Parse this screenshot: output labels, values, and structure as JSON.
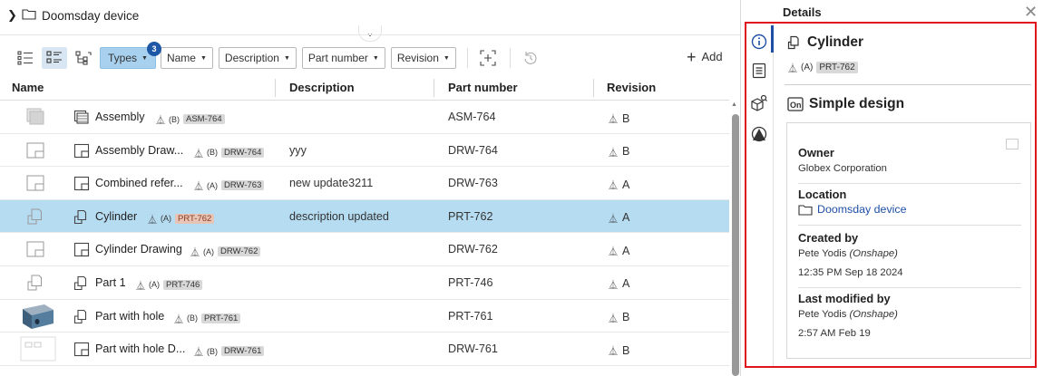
{
  "breadcrumb": {
    "folder": "Doomsday device"
  },
  "toolbar": {
    "filters": {
      "types": "Types",
      "types_count": "3",
      "name": "Name",
      "description": "Description",
      "part_number": "Part number",
      "revision": "Revision"
    },
    "add_label": "Add"
  },
  "columns": {
    "name": "Name",
    "description": "Description",
    "part_number": "Part number",
    "revision": "Revision"
  },
  "rows": [
    {
      "name": "Assembly",
      "rev": "(B)",
      "pn_chip": "ASM-764",
      "description": "",
      "part_number": "ASM-764",
      "revision": "B",
      "type": "assembly"
    },
    {
      "name": "Assembly Draw...",
      "rev": "(B)",
      "pn_chip": "DRW-764",
      "description": "yyy",
      "part_number": "DRW-764",
      "revision": "B",
      "type": "drawing"
    },
    {
      "name": "Combined refer...",
      "rev": "(A)",
      "pn_chip": "DRW-763",
      "description": "new update3211",
      "part_number": "DRW-763",
      "revision": "A",
      "type": "drawing"
    },
    {
      "name": "Cylinder",
      "rev": "(A)",
      "pn_chip": "PRT-762",
      "description": "description updated",
      "part_number": "PRT-762",
      "revision": "A",
      "type": "part",
      "selected": true
    },
    {
      "name": "Cylinder Drawing",
      "rev": "(A)",
      "pn_chip": "DRW-762",
      "description": "",
      "part_number": "DRW-762",
      "revision": "A",
      "type": "drawing"
    },
    {
      "name": "Part 1",
      "rev": "(A)",
      "pn_chip": "PRT-746",
      "description": "",
      "part_number": "PRT-746",
      "revision": "A",
      "type": "part"
    },
    {
      "name": "Part with hole",
      "rev": "(B)",
      "pn_chip": "PRT-761",
      "description": "",
      "part_number": "PRT-761",
      "revision": "B",
      "type": "part-3d"
    },
    {
      "name": "Part with hole D...",
      "rev": "(B)",
      "pn_chip": "DRW-761",
      "description": "",
      "part_number": "DRW-761",
      "revision": "B",
      "type": "drawing-thumb"
    }
  ],
  "details": {
    "title": "Details",
    "object": {
      "name": "Cylinder",
      "rev": "(A)",
      "pn_chip": "PRT-762"
    },
    "document": {
      "name": "Simple design",
      "owner_label": "Owner",
      "owner": "Globex Corporation",
      "location_label": "Location",
      "location": "Doomsday device",
      "created_label": "Created by",
      "created_by": "Pete Yodis",
      "created_by_org": "(Onshape)",
      "created_at": "12:35 PM Sep 18 2024",
      "modified_label": "Last modified by",
      "modified_by": "Pete Yodis",
      "modified_by_org": "(Onshape)",
      "modified_at": "2:57 AM Feb 19"
    }
  },
  "colors": {
    "selected_row": "#b6dcf2",
    "accent": "#1e4fa5",
    "highlight_box": "#e0141b",
    "types_filter": "#a7d1ee"
  }
}
